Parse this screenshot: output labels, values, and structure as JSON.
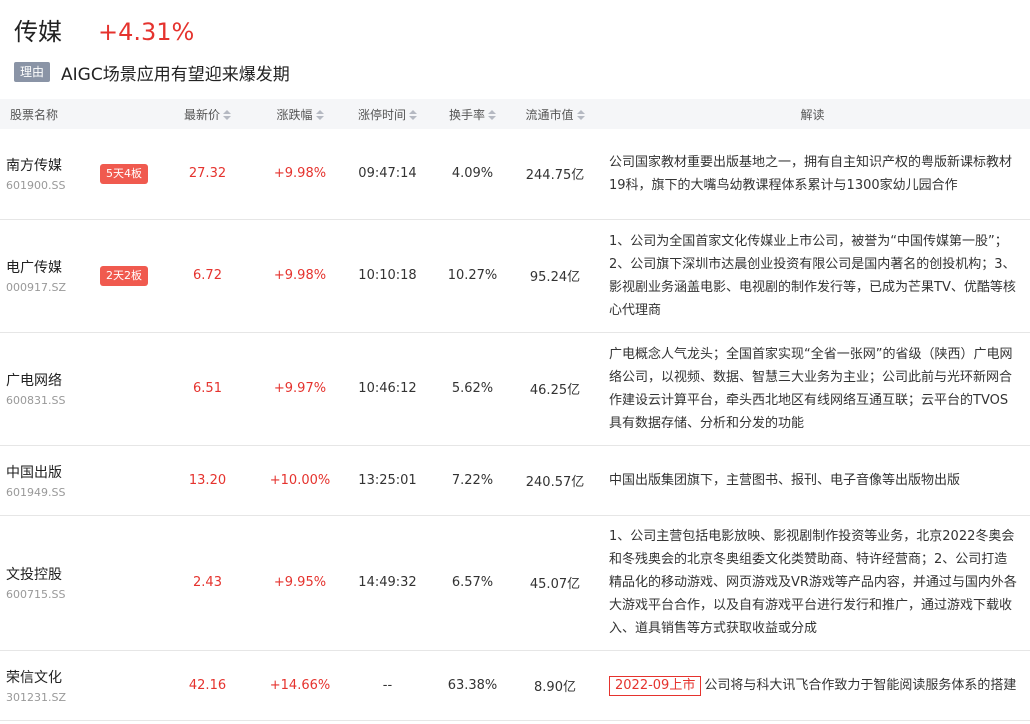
{
  "sector": {
    "name": "传媒",
    "change": "+4.31%"
  },
  "reason": {
    "tag": "理由",
    "text": "AIGC场景应用有望迎来爆发期"
  },
  "columns": {
    "name": "股票名称",
    "price": "最新价",
    "change": "涨跌幅",
    "limit_time": "涨停时间",
    "turnover": "换手率",
    "market_cap": "流通市值",
    "desc": "解读"
  },
  "rows": [
    {
      "name": "南方传媒",
      "code": "601900.SS",
      "badge": "5天4板",
      "price": "27.32",
      "change": "+9.98%",
      "limit_time": "09:47:14",
      "turnover": "4.09%",
      "market_cap": "244.75亿",
      "tag": "",
      "desc": "公司国家教材重要出版基地之一，拥有自主知识产权的粤版新课标教材19科，旗下的大嘴鸟幼教课程体系累计与1300家幼儿园合作"
    },
    {
      "name": "电广传媒",
      "code": "000917.SZ",
      "badge": "2天2板",
      "price": "6.72",
      "change": "+9.98%",
      "limit_time": "10:10:18",
      "turnover": "10.27%",
      "market_cap": "95.24亿",
      "tag": "",
      "desc": "1、公司为全国首家文化传媒业上市公司，被誉为“中国传媒第一股”；2、公司旗下深圳市达晨创业投资有限公司是国内著名的创投机构；3、影视剧业务涵盖电影、电视剧的制作发行等，已成为芒果TV、优酷等核心代理商"
    },
    {
      "name": "广电网络",
      "code": "600831.SS",
      "badge": "",
      "price": "6.51",
      "change": "+9.97%",
      "limit_time": "10:46:12",
      "turnover": "5.62%",
      "market_cap": "46.25亿",
      "tag": "",
      "desc": "广电概念人气龙头；全国首家实现“全省一张网”的省级（陕西）广电网络公司，以视频、数据、智慧三大业务为主业；公司此前与光环新网合作建设云计算平台，牵头西北地区有线网络互通互联；云平台的TVOS具有数据存储、分析和分发的功能"
    },
    {
      "name": "中国出版",
      "code": "601949.SS",
      "badge": "",
      "price": "13.20",
      "change": "+10.00%",
      "limit_time": "13:25:01",
      "turnover": "7.22%",
      "market_cap": "240.57亿",
      "tag": "",
      "desc": "中国出版集团旗下，主营图书、报刊、电子音像等出版物出版"
    },
    {
      "name": "文投控股",
      "code": "600715.SS",
      "badge": "",
      "price": "2.43",
      "change": "+9.95%",
      "limit_time": "14:49:32",
      "turnover": "6.57%",
      "market_cap": "45.07亿",
      "tag": "",
      "desc": "1、公司主营包括电影放映、影视剧制作投资等业务，北京2022冬奥会和冬残奥会的北京冬奥组委文化类赞助商、特许经营商；2、公司打造精品化的移动游戏、网页游戏及VR游戏等产品内容，并通过与国内外各大游戏平台合作，以及自有游戏平台进行发行和推广，通过游戏下载收入、道具销售等方式获取收益或分成"
    },
    {
      "name": "荣信文化",
      "code": "301231.SZ",
      "badge": "",
      "price": "42.16",
      "change": "+14.66%",
      "limit_time": "--",
      "turnover": "63.38%",
      "market_cap": "8.90亿",
      "tag": "2022-09上市",
      "desc": "公司将与科大讯飞合作致力于智能阅读服务体系的搭建"
    }
  ],
  "colors": {
    "up": "#e5332e",
    "badge": "#f05a4f",
    "reason_tag": "#8a94a6",
    "header_bg": "#f5f6f8"
  },
  "icons": {
    "sort": "sort-icon"
  }
}
